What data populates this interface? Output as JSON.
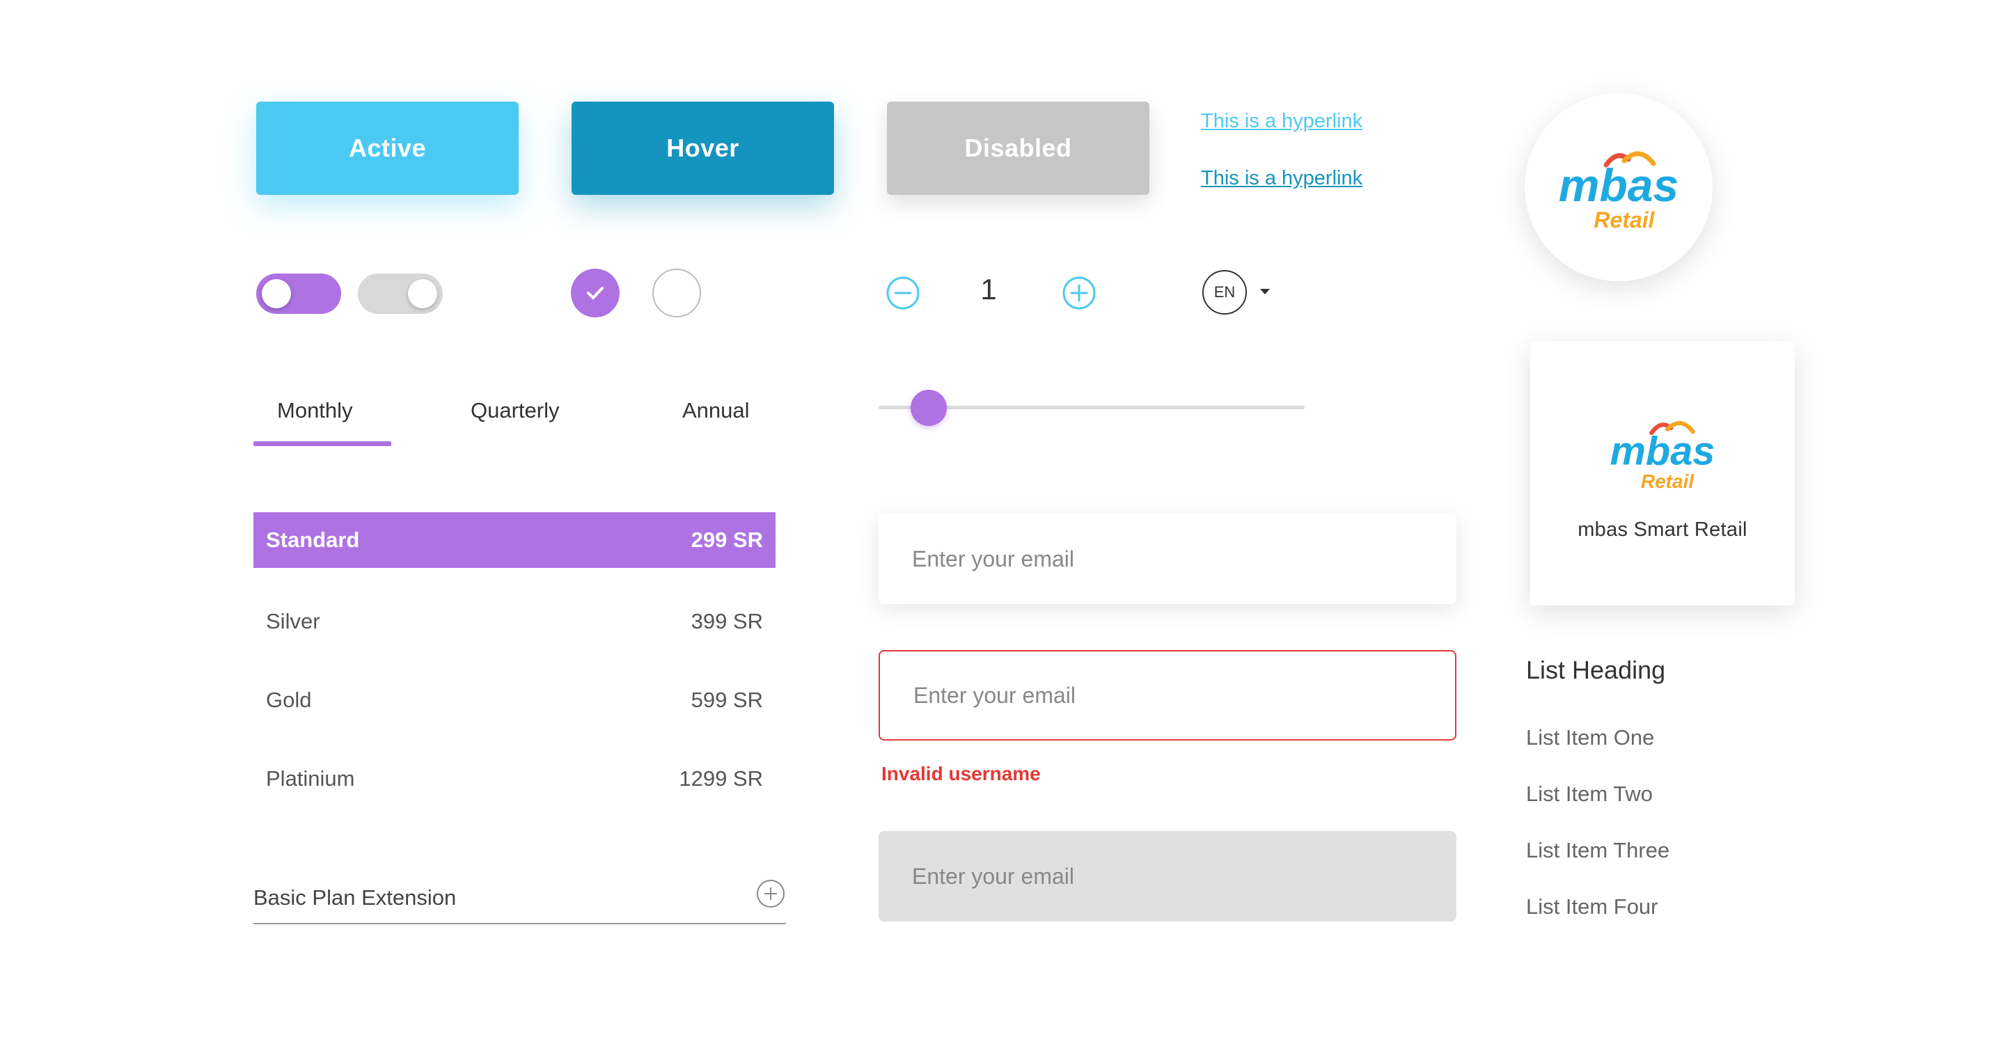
{
  "buttons": {
    "active": "Active",
    "hover": "Hover",
    "disabled": "Disabled"
  },
  "links": [
    "This is a hyperlink",
    "This is a hyperlink"
  ],
  "brand": {
    "name": "mbas",
    "sub": "Retail",
    "card_label": "mbas Smart Retail",
    "colors": {
      "mbas": "#1fa9e1",
      "retail": "#f5a623",
      "arc_red": "#e94e3c",
      "arc_orange": "#f5a623"
    }
  },
  "colors": {
    "accent_purple": "#ae72e3",
    "active_blue": "#4cc9f2",
    "hover_blue": "#1494be",
    "disabled_gray": "#c6c6c6",
    "error_red": "#e53935"
  },
  "toggles": [
    {
      "state": "on"
    },
    {
      "state": "off"
    }
  ],
  "radios": [
    {
      "state": "checked",
      "icon": "check-icon"
    },
    {
      "state": "unchecked"
    }
  ],
  "stepper": {
    "value": "1",
    "minus_icon": "minus-circle-icon",
    "plus_icon": "plus-circle-icon"
  },
  "language": {
    "code": "EN",
    "caret_icon": "caret-down-icon"
  },
  "tabs": [
    {
      "label": "Monthly",
      "selected": true
    },
    {
      "label": "Quarterly",
      "selected": false
    },
    {
      "label": "Annual",
      "selected": false
    }
  ],
  "slider": {
    "value_fraction": 0.06
  },
  "plans": [
    {
      "name": "Standard",
      "price": "299 SR",
      "selected": true
    },
    {
      "name": "Silver",
      "price": "399 SR",
      "selected": false
    },
    {
      "name": "Gold",
      "price": "599 SR",
      "selected": false
    },
    {
      "name": "Platinium",
      "price": "1299 SR",
      "selected": false
    }
  ],
  "accordion": {
    "label": "Basic Plan Extension",
    "icon": "plus-circle-icon"
  },
  "inputs": {
    "placeholder": "Enter your email",
    "error_message": "Invalid username"
  },
  "list": {
    "heading": "List Heading",
    "items": [
      "List Item One",
      "List Item Two",
      "List Item Three",
      "List Item Four"
    ]
  }
}
